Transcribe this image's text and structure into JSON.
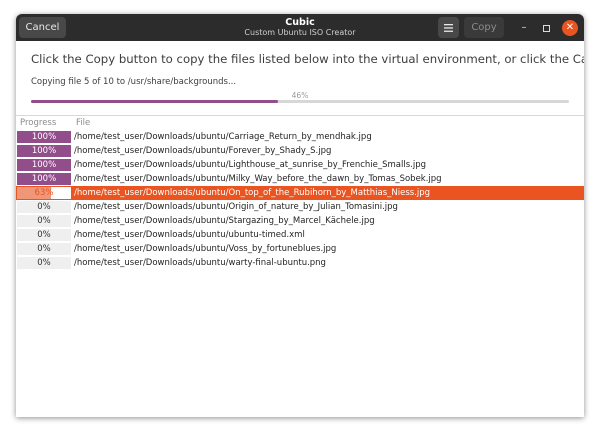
{
  "window": {
    "title": "Cubic",
    "subtitle": "Custom Ubuntu ISO Creator",
    "cancel_label": "Cancel",
    "copy_label": "Copy",
    "menu_icon": "hamburger-menu-icon",
    "minimize_glyph": "–",
    "close_glyph": "✕"
  },
  "main": {
    "message": "Click the Copy button to copy the files listed below into the virtual environment, or click the Cancel button.",
    "status": "Copying file 5 of 10 to /usr/share/backgrounds...",
    "overall_progress_text": "46%",
    "overall_progress": 0.46
  },
  "table": {
    "columns": [
      "Progress",
      "File"
    ],
    "rows": [
      {
        "progress": 1.0,
        "progress_label": "100%",
        "file": "/home/test_user/Downloads/ubuntu/Carriage_Return_by_mendhak.jpg"
      },
      {
        "progress": 1.0,
        "progress_label": "100%",
        "file": "/home/test_user/Downloads/ubuntu/Forever_by_Shady_S.jpg"
      },
      {
        "progress": 1.0,
        "progress_label": "100%",
        "file": "/home/test_user/Downloads/ubuntu/Lighthouse_at_sunrise_by_Frenchie_Smalls.jpg"
      },
      {
        "progress": 1.0,
        "progress_label": "100%",
        "file": "/home/test_user/Downloads/ubuntu/Milky_Way_before_the_dawn_by_Tomas_Sobek.jpg"
      },
      {
        "progress": 0.63,
        "progress_label": "63%",
        "file": "/home/test_user/Downloads/ubuntu/On_top_of_the_Rubihorn_by_Matthias_Niess.jpg",
        "active": true
      },
      {
        "progress": 0,
        "progress_label": "0%",
        "file": "/home/test_user/Downloads/ubuntu/Origin_of_nature_by_Julian_Tomasini.jpg"
      },
      {
        "progress": 0,
        "progress_label": "0%",
        "file": "/home/test_user/Downloads/ubuntu/Stargazing_by_Marcel_Kächele.jpg"
      },
      {
        "progress": 0,
        "progress_label": "0%",
        "file": "/home/test_user/Downloads/ubuntu/ubuntu-timed.xml"
      },
      {
        "progress": 0,
        "progress_label": "0%",
        "file": "/home/test_user/Downloads/ubuntu/Voss_by_fortuneblues.jpg"
      },
      {
        "progress": 0,
        "progress_label": "0%",
        "file": "/home/test_user/Downloads/ubuntu/warty-final-ubuntu.png"
      }
    ]
  },
  "colors": {
    "titlebar": "#2c2c2c",
    "progress_accent": "#924d8b",
    "selection_accent": "#e95420"
  }
}
